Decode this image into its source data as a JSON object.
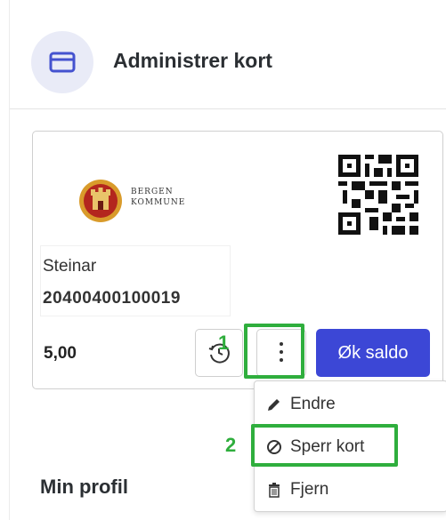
{
  "header": {
    "title": "Administrer kort",
    "icon": "credit-card-icon"
  },
  "card": {
    "logo": {
      "line1": "BERGEN",
      "line2": "KOMMUNE"
    },
    "holder_name": "Steinar",
    "card_number": "20400400100019",
    "balance": "5,00",
    "topup_label": "Øk saldo",
    "history_icon": "history-icon",
    "more_icon": "more-vertical-icon"
  },
  "annotations": {
    "step1": "1",
    "step2": "2",
    "highlight_color": "#2fae3d"
  },
  "menu": {
    "items": [
      {
        "label": "Endre",
        "icon": "pencil-icon"
      },
      {
        "label": "Sperr kort",
        "icon": "block-icon"
      },
      {
        "label": "Fjern",
        "icon": "trash-icon"
      }
    ]
  },
  "section": {
    "title": "Min profil"
  },
  "colors": {
    "primary": "#3c47d6",
    "icon_bg": "#e9ebf7"
  }
}
